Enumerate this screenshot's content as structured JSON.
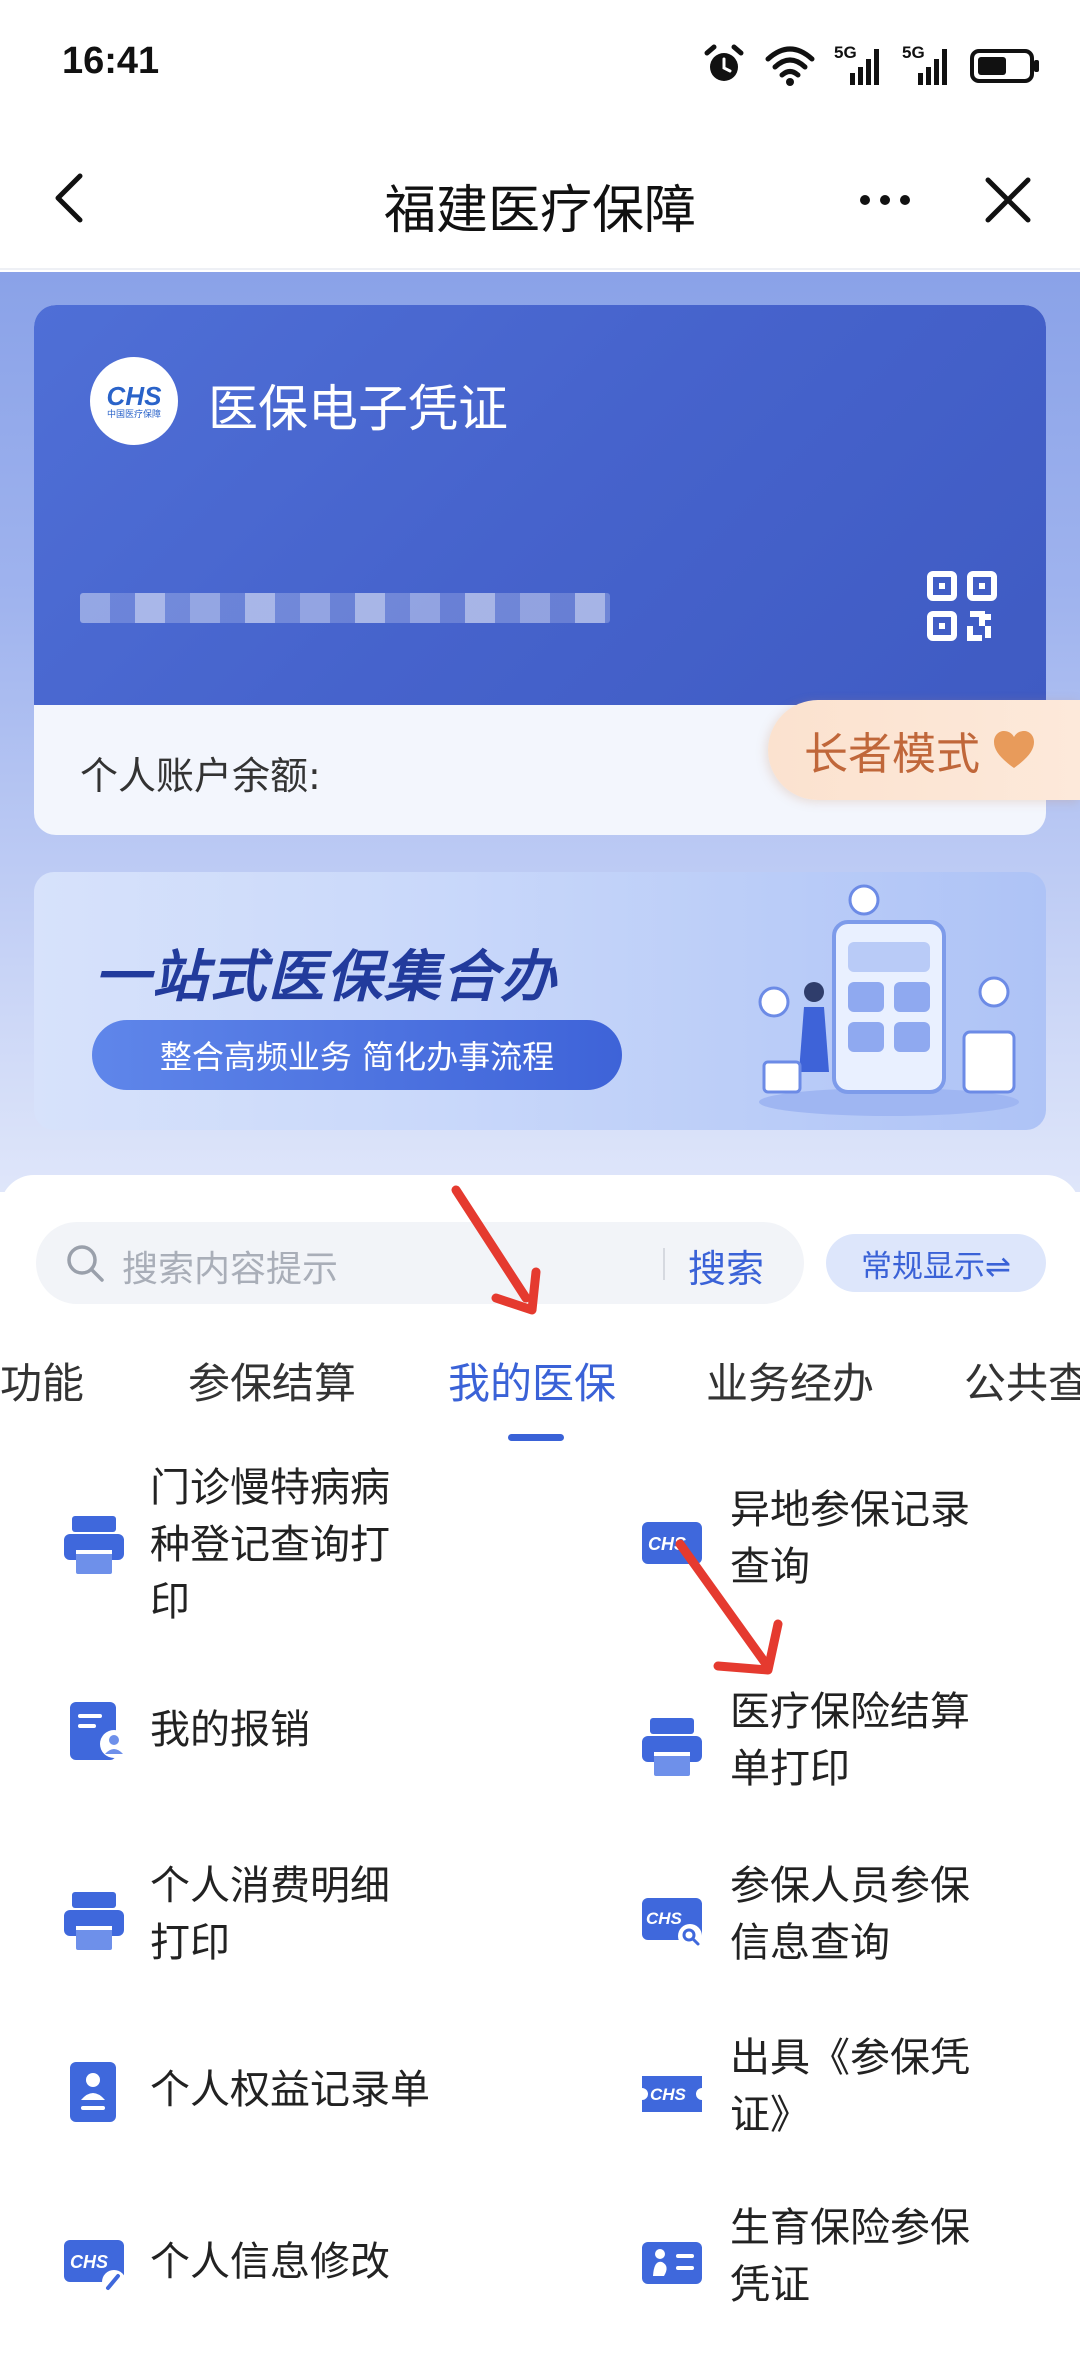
{
  "status_bar": {
    "time": "16:41",
    "net1": "5G",
    "net2": "5G"
  },
  "nav": {
    "title": "福建医疗保障",
    "back_icon": "chevron-left-icon",
    "more_icon": "more-dots-icon",
    "close_icon": "close-icon"
  },
  "card": {
    "logo_text": "CHS",
    "logo_sub": "中国医疗保障",
    "title": "医保电子凭证",
    "balance_label": "个人账户余额:",
    "qr_icon": "qr-code-icon"
  },
  "elder_mode": {
    "label": "长者模式",
    "icon": "heart-icon"
  },
  "banner": {
    "title": "一站式医保集合办",
    "subtitle": "整合高频业务 简化办事流程"
  },
  "search": {
    "placeholder": "搜索内容提示",
    "button": "搜索"
  },
  "display_toggle": "常规显示⇌",
  "tabs": [
    "用功能",
    "参保结算",
    "我的医保",
    "业务经办",
    "公共查"
  ],
  "active_tab": "我的医保",
  "items_left": [
    {
      "label_lines": [
        "门诊慢特病病",
        "种登记查询打",
        "印"
      ],
      "icon": "printer-icon"
    },
    {
      "label_lines": [
        "我的报销"
      ],
      "icon": "document-user-icon"
    },
    {
      "label_lines": [
        "个人消费明细",
        "打印"
      ],
      "icon": "printer-icon"
    },
    {
      "label_lines": [
        "个人权益记录单"
      ],
      "icon": "person-card-icon"
    },
    {
      "label_lines": [
        "个人信息修改"
      ],
      "icon": "chs-edit-icon"
    }
  ],
  "items_right": [
    {
      "label_lines": [
        "异地参保记录",
        "查询"
      ],
      "icon": "chs-card-icon"
    },
    {
      "label_lines": [
        "医疗保险结算",
        "单打印"
      ],
      "icon": "printer-icon"
    },
    {
      "label_lines": [
        "参保人员参保",
        "信息查询"
      ],
      "icon": "chs-search-icon"
    },
    {
      "label_lines": [
        "出具《参保凭",
        "证》"
      ],
      "icon": "chs-ticket-icon"
    },
    {
      "label_lines": [
        "生育保险参保",
        "凭证"
      ],
      "icon": "maternity-card-icon"
    }
  ],
  "colors": {
    "primary": "#3a62d7",
    "card_blue": "#4663cc",
    "arrow_red": "#e53a2f",
    "elder_text": "#c0673a"
  }
}
